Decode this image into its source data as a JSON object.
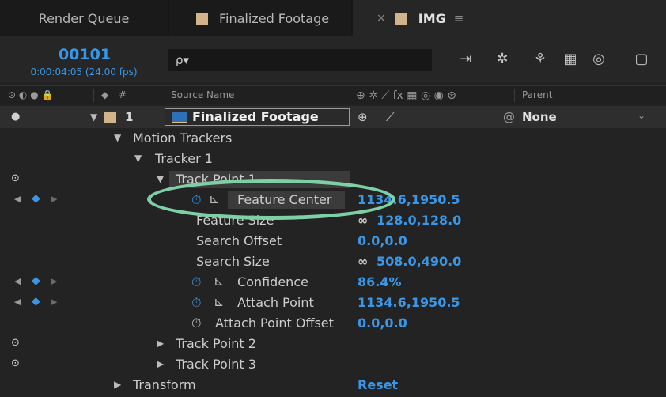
{
  "tabs": {
    "render_queue": "Render Queue",
    "finalized_footage": "Finalized Footage",
    "img": "IMG",
    "close_glyph": "×",
    "menu_glyph": "≡",
    "swatch_color": "#d2b48a"
  },
  "composition": {
    "timecode": "00101",
    "time_fps": "0:00:04:05 (24.00 fps)",
    "search_placeholder": "ρ▾"
  },
  "columns": {
    "source_name": "Source Name",
    "parent": "Parent",
    "hash": "#"
  },
  "layer": {
    "number": "1",
    "name": "Finalized Footage",
    "parent_value": "None"
  },
  "tree": {
    "motion_trackers": "Motion Trackers",
    "tracker1": "Tracker 1",
    "track_point1": "Track Point 1",
    "feature_center_label": "Feature Center",
    "feature_center_value": "1134.6,1950.5",
    "feature_size_label": "Feature Size",
    "feature_size_value": "128.0,128.0",
    "search_offset_label": "Search Offset",
    "search_offset_value": "0.0,0.0",
    "search_size_label": "Search Size",
    "search_size_value": "508.0,490.0",
    "confidence_label": "Confidence",
    "confidence_value": "86.4%",
    "attach_point_label": "Attach Point",
    "attach_point_value": "1134.6,1950.5",
    "attach_point_offset_label": "Attach Point Offset",
    "attach_point_offset_value": "0.0,0.0",
    "track_point2": "Track Point 2",
    "track_point3": "Track Point 3",
    "transform": "Transform",
    "transform_reset": "Reset"
  },
  "colors": {
    "accent_blue": "#3a97e8",
    "highlight_ellipse": "#7fcfa6"
  }
}
